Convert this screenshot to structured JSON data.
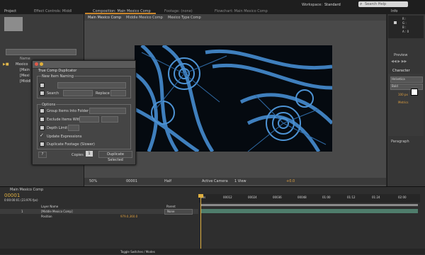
{
  "topbar": {
    "project_tab": "Project",
    "effect_controls_tab": "Effect Controls: Middl",
    "composition_tab": "Composition: Main Mexico Comp",
    "footage_tab": "Footage: (none)",
    "flowchart_tab": "Flowchart: Main Mexico Comp",
    "workspace_label": "Workspace:",
    "workspace_value": "Standard",
    "search_placeholder": "Search Help"
  },
  "comp_subtabs": [
    "Main Mexico Comp",
    "Middle Mexico Comp",
    "Mexico Type Comp"
  ],
  "project": {
    "search_placeholder": "",
    "col_name": "Name",
    "items": [
      "Mexico",
      "[Main",
      "[Mexi",
      "[Middl"
    ]
  },
  "dialog": {
    "title": "True Comp Duplicator",
    "new_item_naming": "New Item Naming",
    "search_label": "Search",
    "replace_label": "Replace",
    "options_label": "Options",
    "group_items": "Group Items Into Folder",
    "exclude_items": "Exclude Items With",
    "depth_limit": "Depth Limit",
    "update_expressions": "Update Expressions",
    "duplicate_footage": "Duplicate Footage (Slower)",
    "copies_label": "Copies",
    "copies_value": "1",
    "help_button": "?",
    "duplicate_button": "Duplicate Selected"
  },
  "viewer_controls": {
    "zoom": "50%",
    "timecode": "00001",
    "resolution": "Half",
    "camera": "Active Camera",
    "view": "1 View",
    "exposure": "+0.0"
  },
  "right_panels": {
    "info": "Info",
    "info_lines": [
      "R :",
      "G :",
      "B :",
      "A : 0"
    ],
    "preview": "Preview",
    "character": "Character",
    "font": "Helvetica",
    "style": "Bold",
    "size": "100 px",
    "tracking": "Metrics",
    "paragraph": "Paragraph"
  },
  "timeline": {
    "tab": "Main Mexico Comp",
    "timecode": "00001",
    "timecode_sub": "0:00:00:01 (23.976 fps)",
    "col_layer_name": "Layer Name",
    "col_parent": "Parent",
    "layer_name": "[Middle Mexico Comp]",
    "layer_index": "1",
    "property": "Position",
    "property_value": "979.0,360.0",
    "parent_value": "None",
    "ruler_ticks": [
      "00s",
      "00f",
      "00012",
      "00024",
      "00036",
      "00048",
      "01:00",
      "01:12",
      "01:24",
      "02:00"
    ],
    "toggle_label": "Toggle Switches / Modes"
  }
}
